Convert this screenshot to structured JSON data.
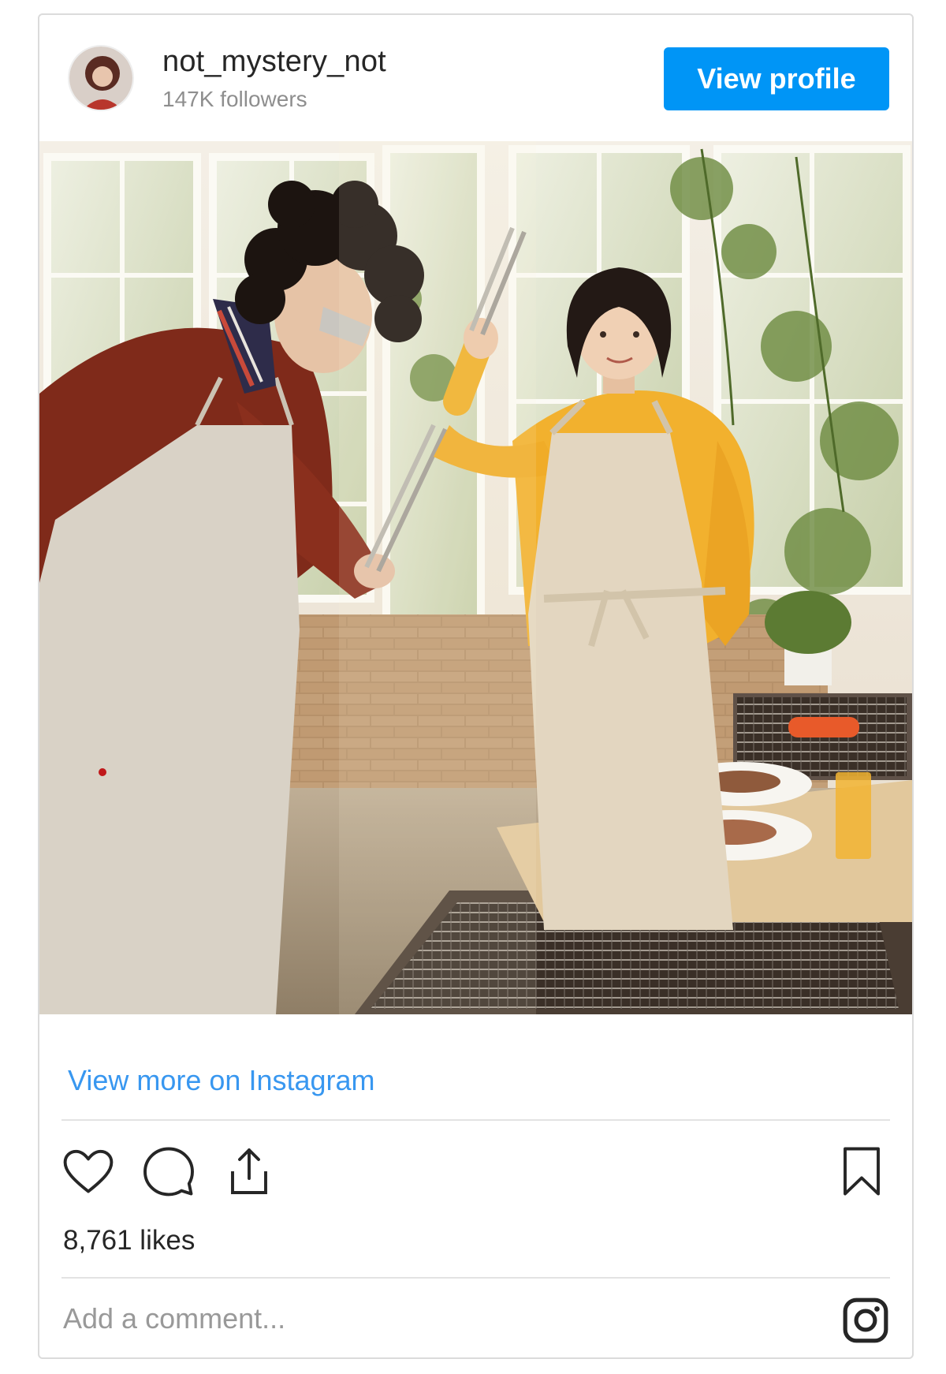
{
  "post": {
    "username": "not_mystery_not",
    "followers": "147K followers",
    "view_profile_label": "View profile",
    "view_more_label": "View more on Instagram",
    "likes": "8,761 likes",
    "comment_placeholder": "Add a comment..."
  },
  "icons": {
    "like": "heart-icon",
    "comment": "comment-icon",
    "share": "share-icon",
    "save": "bookmark-icon",
    "logo": "instagram-icon"
  },
  "colors": {
    "accent": "#0095f6",
    "link": "#3897f0",
    "text": "#262626",
    "muted": "#8e8e8e",
    "border": "#dbdbdb"
  }
}
